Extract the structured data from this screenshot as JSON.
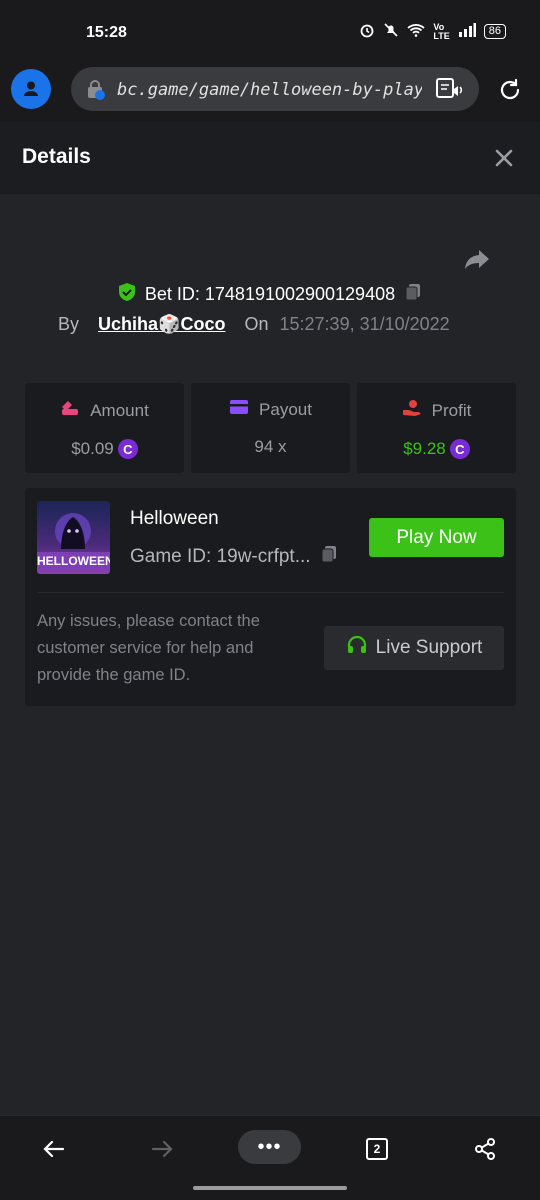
{
  "status_bar": {
    "time": "15:28",
    "battery": "86"
  },
  "browser": {
    "url": "bc.game/game/helloween-by-playngo"
  },
  "details": {
    "title": "Details"
  },
  "bet": {
    "bet_id_label": "Bet ID: 1748191002900129408",
    "by_label": "By",
    "user": "Uchiha🎲Coco",
    "on_label": "On",
    "datetime": "15:27:39, 31/10/2022"
  },
  "stats": [
    {
      "label": "Amount",
      "value": "$0.09",
      "color": "#e8457e"
    },
    {
      "label": "Payout",
      "value": "94 x",
      "color": "#8b4dff"
    },
    {
      "label": "Profit",
      "value": "$9.28",
      "color": "#e23f3f"
    }
  ],
  "game": {
    "thumb_label": "HELLOWEEN",
    "name": "Helloween",
    "game_id": "Game ID: 19w-crfpt...",
    "play_label": "Play Now",
    "issue_text": "Any issues, please contact the customer service for help and provide the game ID.",
    "support_label": "Live Support"
  },
  "nav": {
    "menu_dots": "•••",
    "tabs_count": "2"
  },
  "colors": {
    "accent_green": "#3bc117",
    "coin_purple": "#7a2bd6",
    "background": "#232428"
  }
}
